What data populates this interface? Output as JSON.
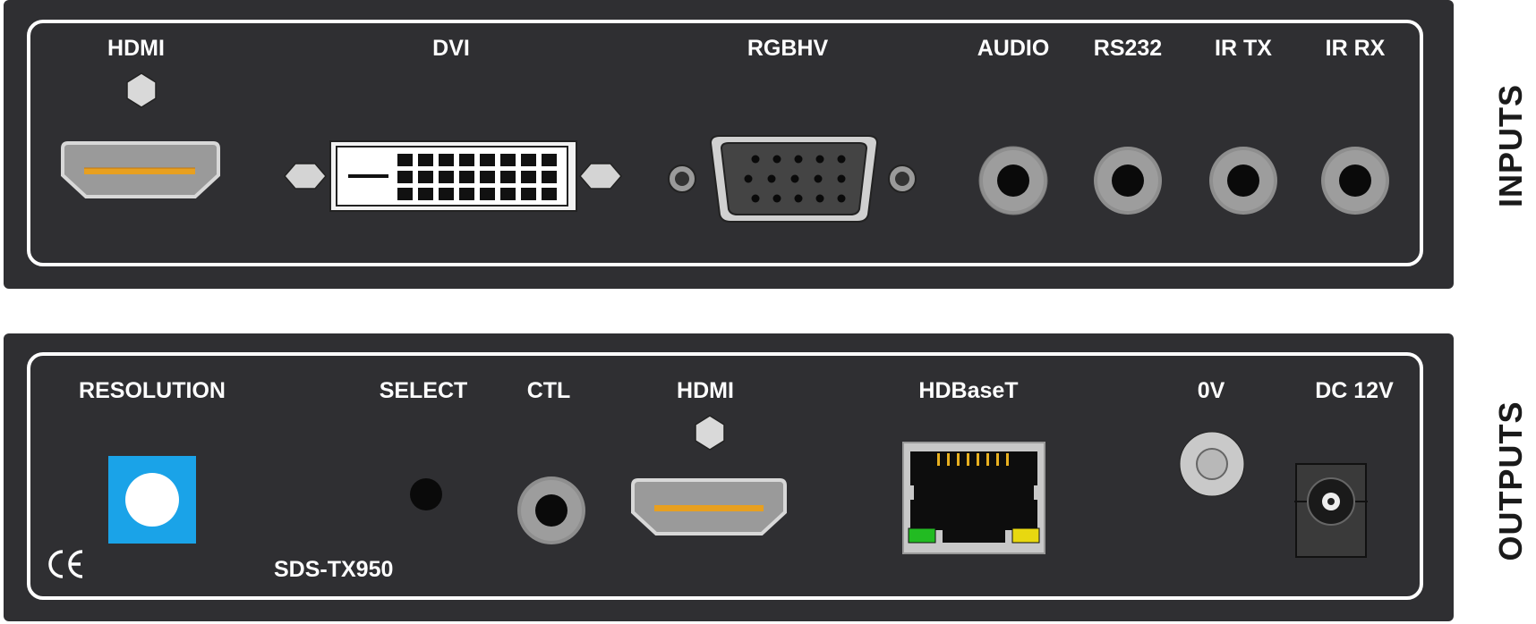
{
  "inputs": {
    "side_label": "INPUTS",
    "ports": {
      "hdmi": "HDMI",
      "dvi": "DVI",
      "rgbhv": "RGBHV",
      "audio": "AUDIO",
      "rs232": "RS232",
      "ir_tx": "IR TX",
      "ir_rx": "IR RX"
    }
  },
  "outputs": {
    "side_label": "OUTPUTS",
    "ports": {
      "resolution": "RESOLUTION",
      "select": "SELECT",
      "ctl": "CTL",
      "hdmi": "HDMI",
      "hdbaset": "HDBaseT",
      "zero_v": "0V",
      "dc": "DC 12V"
    },
    "model": "SDS-TX950",
    "ce_mark": "CE"
  },
  "colors": {
    "panel": "#2f2f32",
    "frame": "#ffffff",
    "resolution_button": "#1aa3e8",
    "hdmi_pins": "#e8a020",
    "led_green": "#22bb22",
    "led_yellow": "#e8d810"
  }
}
